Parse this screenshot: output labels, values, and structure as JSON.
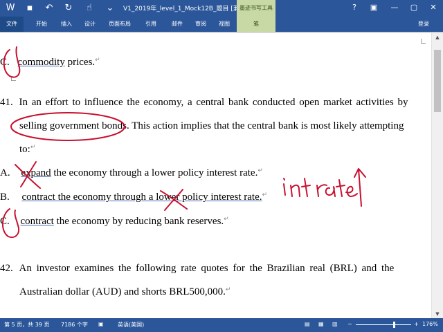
{
  "titlebar": {
    "doc_title": "V1_2019年_level_1_Mock12B_题目 [兼容模...",
    "tool_context_tab": "墨迹书写工具",
    "help": "?",
    "restore_ribbon": "▣",
    "minimize": "—",
    "maximize": "▢",
    "close": "✕"
  },
  "ribbon": {
    "tabs": [
      {
        "label": "文件"
      },
      {
        "label": "开始"
      },
      {
        "label": "插入"
      },
      {
        "label": "设计"
      },
      {
        "label": "页面布局"
      },
      {
        "label": "引用"
      },
      {
        "label": "邮件"
      },
      {
        "label": "审阅"
      },
      {
        "label": "视图"
      },
      {
        "label": "笔"
      }
    ],
    "login": "登录"
  },
  "document": {
    "line_c_prev_letter": "C.",
    "line_c_prev_word": "commodity",
    "line_c_prev_rest": " prices.",
    "q41_num": "41.",
    "q41_line1": "In an effort to influence the economy, a central bank conducted open market activities by",
    "q41_line2_a": "selling government bonds",
    "q41_line2_b": ". This action implies that the central bank is most likely attempting",
    "q41_line3": "to:",
    "optA_letter": "A.",
    "optA_word": "expand",
    "optA_rest": " the economy through a lower policy interest rate.",
    "optB_letter": "B.",
    "optB_word": "contract",
    "optB_rest": " the economy through a lower policy interest rate.",
    "optC_letter": "C.",
    "optC_word": "contract",
    "optC_rest": " the economy by reducing bank reserves.",
    "q42_num": "42.",
    "q42_line1": "An investor examines the following rate quotes for the Brazilian real (BRL) and the",
    "q42_line2": "Australian dollar (AUD) and shorts BRL500,000.",
    "para_mark": "↵"
  },
  "annotation": {
    "handwriting": "int rate ↑",
    "ink_color": "#c8102e"
  },
  "statusbar": {
    "page": "第 5 页，共 39 页",
    "words": "7186 个字",
    "language": "英语(美国)",
    "zoom": "176%"
  }
}
